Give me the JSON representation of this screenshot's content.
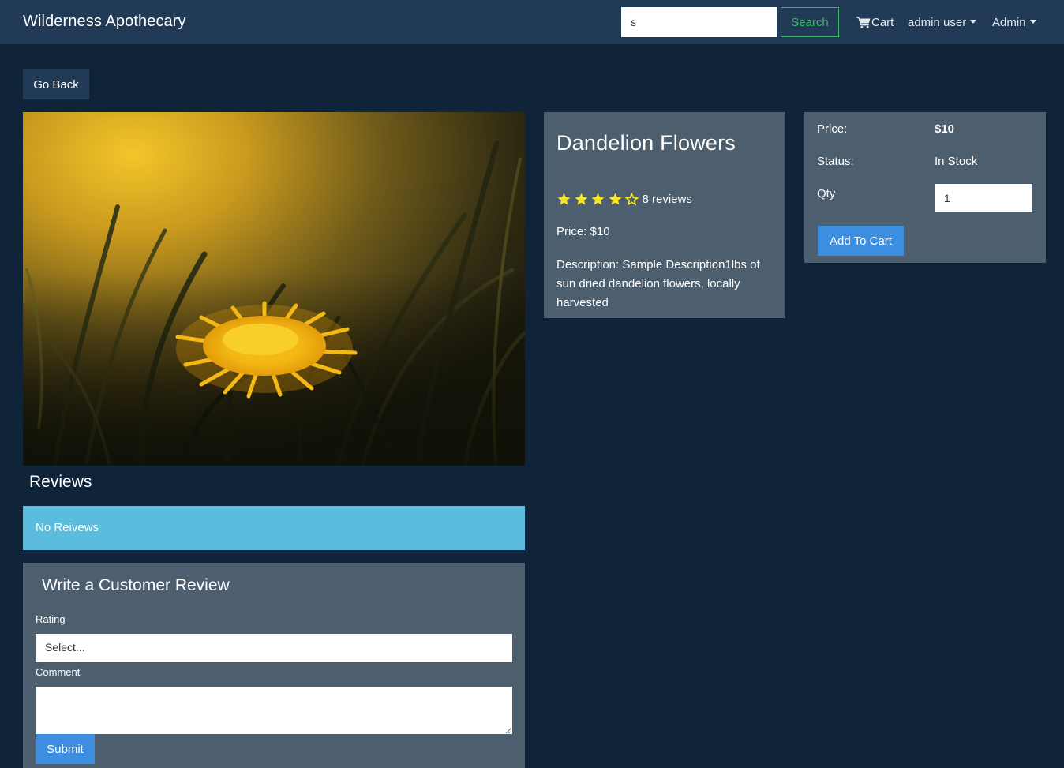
{
  "navbar": {
    "brand": "Wilderness Apothecary",
    "search_value": "s",
    "search_button": "Search",
    "cart_label": "Cart",
    "cart_icon": "shopping-cart-icon",
    "user_menu": "admin user",
    "admin_menu": "Admin"
  },
  "go_back": "Go Back",
  "product": {
    "image_alt": "dandelion flower in tall grass",
    "name": "Dandelion Flowers",
    "rating": 4,
    "rating_max": 5,
    "reviews_label": "8 reviews",
    "price_line": "Price: $10",
    "description": "Description: Sample Description1lbs of sun dried dandelion flowers, locally harvested"
  },
  "purchase": {
    "price_label": "Price:",
    "price_value": "$10",
    "status_label": "Status:",
    "status_value": "In Stock",
    "qty_label": "Qty",
    "qty_value": "1",
    "add_to_cart": "Add To Cart"
  },
  "reviews": {
    "heading": "Reviews",
    "empty_message": "No Reivews",
    "form_title": "Write a Customer Review",
    "rating_label": "Rating",
    "rating_select": "Select...",
    "comment_label": "Comment",
    "comment_value": "",
    "submit": "Submit"
  },
  "colors": {
    "page_bg": "#0f2339",
    "navbar_bg": "#213a55",
    "card_bg": "#4d5e6f",
    "info_bg": "#5bbcdd",
    "primary": "#3d8ee0",
    "success_outline": "#3fb36a",
    "star": "#f8e825"
  }
}
